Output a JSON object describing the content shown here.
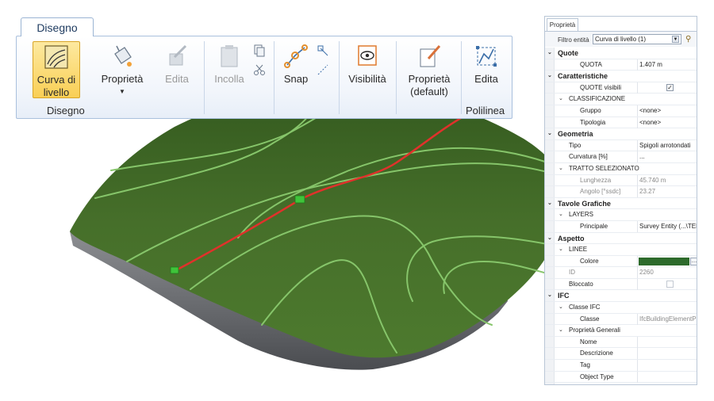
{
  "ribbon": {
    "tab": "Disegno",
    "buttons": {
      "curva": "Curva di livello",
      "proprieta": "Proprietà",
      "edita": "Edita",
      "incolla": "Incolla",
      "snap": "Snap",
      "visibilita": "Visibilità",
      "proprieta_default": "Proprietà (default)",
      "edita2": "Edita"
    },
    "groups": {
      "disegno": "Disegno",
      "polilinea": "Polilinea"
    }
  },
  "panel": {
    "tab": "Proprietà",
    "filter_label": "Filtro entità",
    "filter_value": "Curva di livello (1)",
    "rows": {
      "quote": "Quote",
      "quota_k": "QUOTA",
      "quota_v": "1.407 m",
      "caratteristiche": "Caratteristiche",
      "quote_visibili_k": "QUOTE visibili",
      "classificazione": "CLASSIFICAZIONE",
      "gruppo_k": "Gruppo",
      "gruppo_v": "<none>",
      "tipologia_k": "Tipologia",
      "tipologia_v": "<none>",
      "geometria": "Geometria",
      "tipo_k": "Tipo",
      "tipo_v": "Spigoli arrotondati",
      "curvatura_k": "Curvatura [%]",
      "curvatura_v": "...",
      "tratto": "TRATTO SELEZIONATO",
      "lunghezza_k": "Lunghezza",
      "lunghezza_v": "45.740 m",
      "angolo_k": "Angolo [°ssdc]",
      "angolo_v": "23.27",
      "tavole": "Tavole Grafiche",
      "layers": "LAYERS",
      "principale_k": "Principale",
      "principale_v": "Survey Entity  (...\\TERR",
      "aspetto": "Aspetto",
      "linee": "LINEE",
      "colore_k": "Colore",
      "id_k": "ID",
      "id_v": "2260",
      "bloccato_k": "Bloccato",
      "ifc": "IFC",
      "classe_ifc": "Classe IFC",
      "classe_k": "Classe",
      "classe_v": "IfcBuildingElementProx",
      "prop_generali": "Proprietà Generali",
      "nome_k": "Nome",
      "descrizione_k": "Descrizione",
      "tag_k": "Tag",
      "object_type_k": "Object Type"
    },
    "quote_visibili_checked": true,
    "bloccato_checked": false,
    "line_color": "#2e6b2c"
  },
  "colors": {
    "terrain": "#3f6a26",
    "contour": "#86c56a",
    "selected_contour": "#e0312b",
    "base": "#6d6f74"
  }
}
